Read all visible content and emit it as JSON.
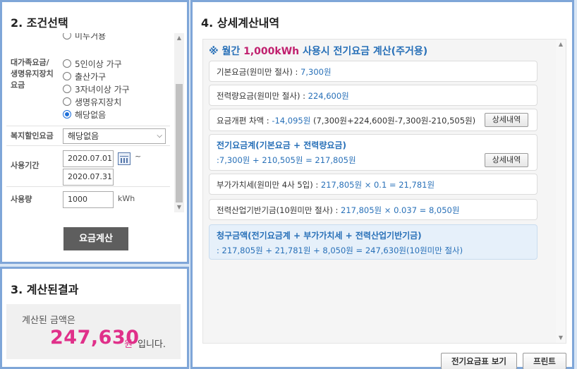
{
  "conditions": {
    "title": "2. 조건선택",
    "top_partial_option": "미두거용",
    "discount_label": "대가족요금/\n생명유지장치\n요금",
    "discount_options": [
      "5인이상 가구",
      "출산가구",
      "3자녀이상 가구",
      "생명유지장치",
      "해당없음"
    ],
    "discount_selected": 4,
    "welfare_label": "복지할인요금",
    "welfare_value": "해당없음",
    "period_label": "사용기간",
    "period_start": "2020.07.01",
    "period_end": "2020.07.31",
    "tilde": "~",
    "usage_label": "사용량",
    "usage_value": "1000",
    "usage_unit": "kWh",
    "calc_button": "요금계산"
  },
  "result": {
    "title": "3. 계산된결과",
    "caption": "계산된 금액은",
    "amount": "247,630",
    "unit": "원",
    "suffix": "입니다."
  },
  "detail": {
    "title": "4. 상세계산내역",
    "heading_prefix": "※ 월간 ",
    "heading_accent": "1,000kWh",
    "heading_suffix": " 사용시 전기요금 계산(주거용)",
    "basic_label": "기본요금(원미만 절사) : ",
    "basic_value": "7,300원",
    "energy_label": "전력량요금(원미만 절사) : ",
    "energy_value": "224,600원",
    "reform_label": "요금개편 차액 : ",
    "reform_value": "-14,095원",
    "reform_formula": " (7,300원+224,600원-7,300원-210,505원)",
    "detail_button": "상세내역",
    "subtotal_title": "전기요금계(기본요금 + 전력량요금)",
    "subtotal_formula": ":7,300원 + 210,505원 = 217,805원",
    "vat_label": "부가가치세(원미만 4사 5입) : ",
    "vat_formula": "217,805원 × 0.1 = 21,781원",
    "fund_label": "전력산업기반기금(10원미만 절사) : ",
    "fund_formula": "217,805원 × 0.037 = 8,050원",
    "total_title": "청구금액(전기요금계 + 부가가치세 + 전력산업기반기금)",
    "total_formula": ": 217,805원 + 21,781원 + 8,050원 = 247,630원(10원미만 절사)",
    "rate_table_button": "전기요금표 보기",
    "print_button": "프린트"
  },
  "colors": {
    "accent_blue": "#2870b8",
    "accent_pink": "#e0308a",
    "panel_border": "#7fa6d8"
  }
}
